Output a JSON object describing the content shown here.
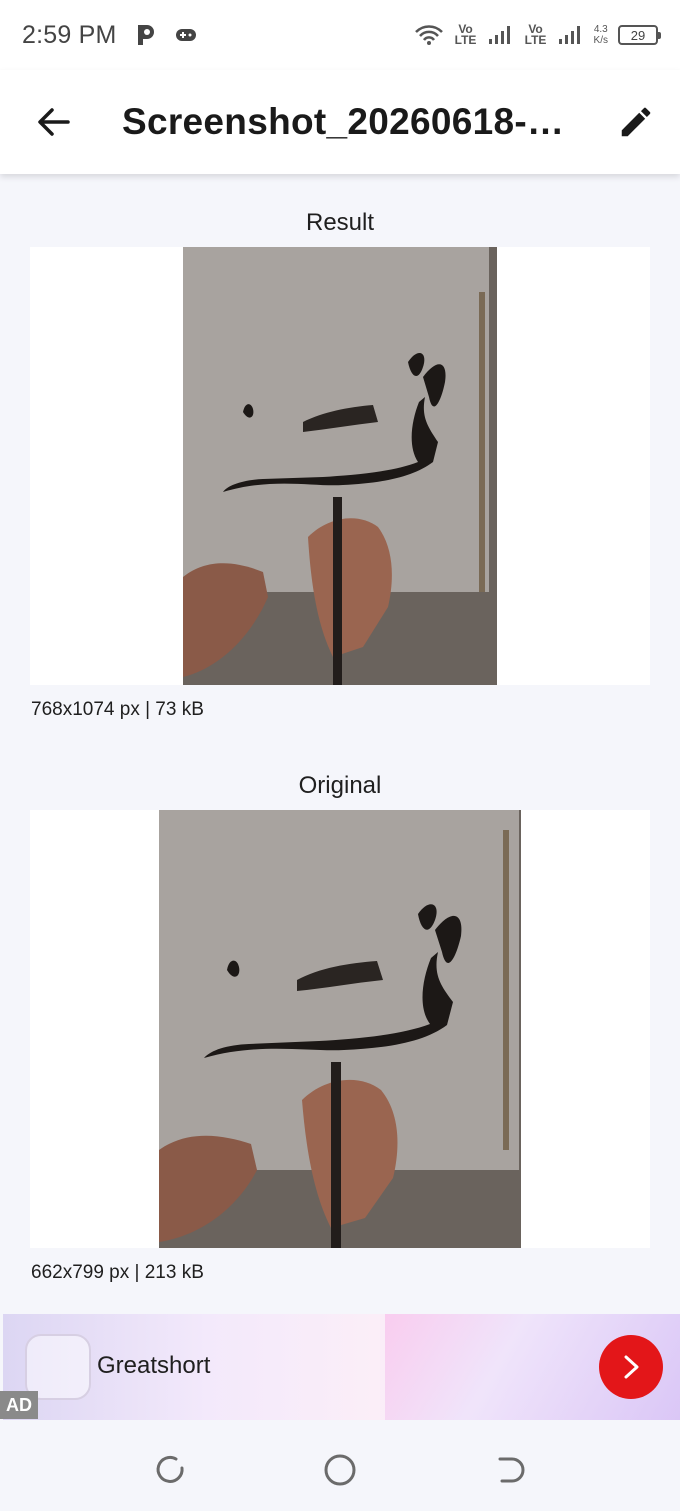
{
  "status_bar": {
    "time": "2:59 PM",
    "volte_1": "Vo LTE",
    "volte_2": "Vo LTE",
    "speed_value": "4.3",
    "speed_unit": "K/s",
    "battery": "29"
  },
  "app_bar": {
    "title": "Screenshot_20260618-…",
    "back_icon": "arrow-left-icon",
    "edit_icon": "pencil-icon"
  },
  "result": {
    "label": "Result",
    "meta": "768x1074 px | 73 kB"
  },
  "original": {
    "label": "Original",
    "meta": "662x799 px | 213 kB"
  },
  "ad": {
    "badge": "AD",
    "app_name": "Greatshort",
    "cta_icon": "chevron-right-icon",
    "cta_color": "#e31619"
  },
  "nav": {
    "recents_icon": "recents-icon",
    "home_icon": "home-circle-icon",
    "back_icon": "back-nav-icon"
  }
}
